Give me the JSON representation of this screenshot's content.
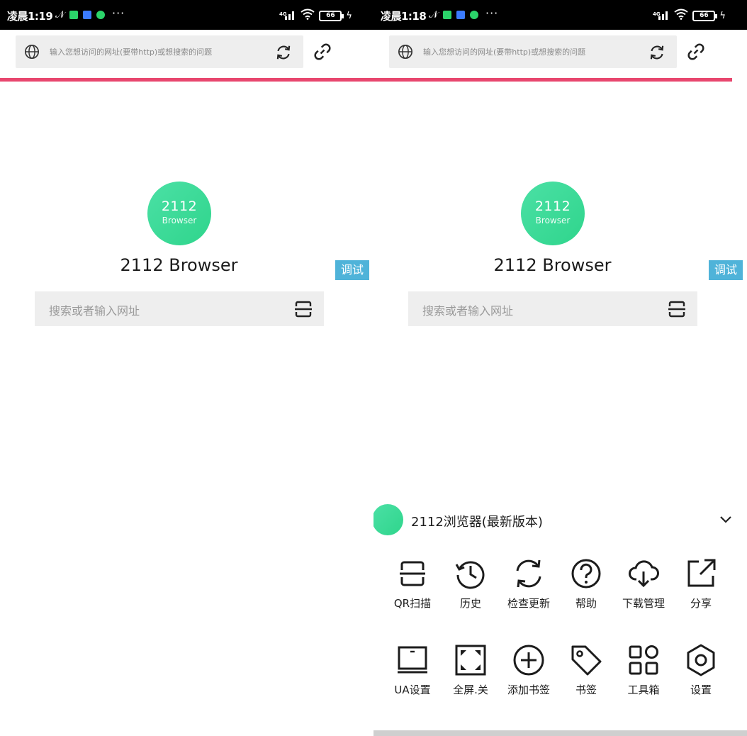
{
  "screens": {
    "left": {
      "status": {
        "time": "凌晨1:19",
        "battery": "66"
      },
      "address_bar": {
        "placeholder": "输入您想访问的网址(要带http)或想搜索的问题"
      },
      "progress": {
        "value": 1.0
      },
      "home": {
        "logo_number": "2112",
        "logo_word": "Browser",
        "title": "2112 Browser",
        "debug_badge": "调试",
        "search_placeholder": "搜索或者输入网址"
      }
    },
    "right": {
      "status": {
        "time": "凌晨1:18",
        "battery": "66"
      },
      "address_bar": {
        "placeholder": "输入您想访问的网址(要带http)或想搜索的问题"
      },
      "progress": {
        "value": 0.96
      },
      "home": {
        "logo_number": "2112",
        "logo_word": "Browser",
        "title": "2112 Browser",
        "debug_badge": "调试",
        "search_placeholder": "搜索或者输入网址"
      },
      "menu": {
        "title": "2112浏览器(最新版本)",
        "items": [
          {
            "label": "QR扫描",
            "icon": "scan-icon"
          },
          {
            "label": "历史",
            "icon": "history-icon"
          },
          {
            "label": "检查更新",
            "icon": "refresh-icon"
          },
          {
            "label": "帮助",
            "icon": "help-icon"
          },
          {
            "label": "下载管理",
            "icon": "cloud-download-icon"
          },
          {
            "label": "分享",
            "icon": "share-icon"
          },
          {
            "label": "UA设置",
            "icon": "monitor-icon"
          },
          {
            "label": "全屏.关",
            "icon": "fullscreen-icon"
          },
          {
            "label": "添加书签",
            "icon": "add-circle-icon"
          },
          {
            "label": "书签",
            "icon": "tag-icon"
          },
          {
            "label": "工具箱",
            "icon": "toolbox-icon"
          },
          {
            "label": "设置",
            "icon": "settings-icon"
          }
        ]
      }
    }
  },
  "colors": {
    "progress": "#e8466e",
    "logo_green": "#2fd58c",
    "debug_badge": "#4fb3d9",
    "status_bar": "#000000"
  }
}
